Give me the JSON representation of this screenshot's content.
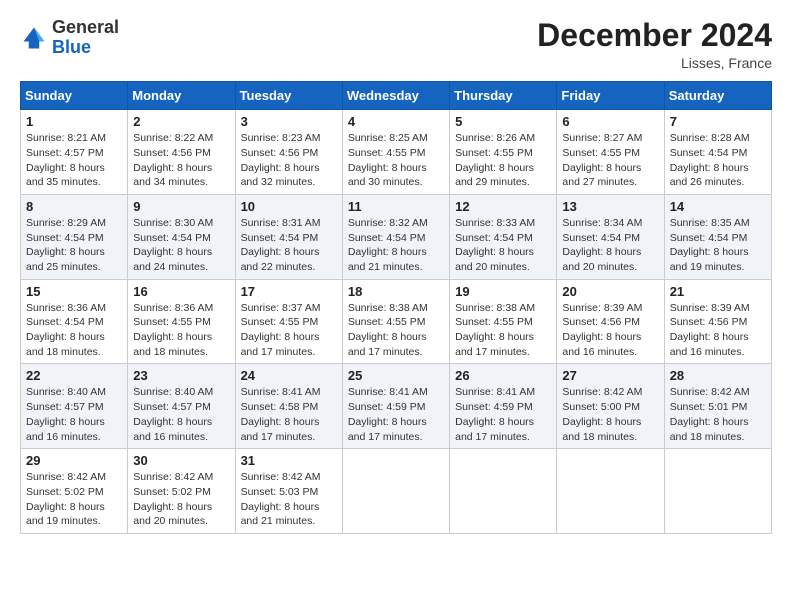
{
  "logo": {
    "general": "General",
    "blue": "Blue"
  },
  "title": "December 2024",
  "location": "Lisses, France",
  "days_of_week": [
    "Sunday",
    "Monday",
    "Tuesday",
    "Wednesday",
    "Thursday",
    "Friday",
    "Saturday"
  ],
  "weeks": [
    [
      {
        "day": "1",
        "sunrise": "8:21 AM",
        "sunset": "4:57 PM",
        "daylight": "8 hours and 35 minutes."
      },
      {
        "day": "2",
        "sunrise": "8:22 AM",
        "sunset": "4:56 PM",
        "daylight": "8 hours and 34 minutes."
      },
      {
        "day": "3",
        "sunrise": "8:23 AM",
        "sunset": "4:56 PM",
        "daylight": "8 hours and 32 minutes."
      },
      {
        "day": "4",
        "sunrise": "8:25 AM",
        "sunset": "4:55 PM",
        "daylight": "8 hours and 30 minutes."
      },
      {
        "day": "5",
        "sunrise": "8:26 AM",
        "sunset": "4:55 PM",
        "daylight": "8 hours and 29 minutes."
      },
      {
        "day": "6",
        "sunrise": "8:27 AM",
        "sunset": "4:55 PM",
        "daylight": "8 hours and 27 minutes."
      },
      {
        "day": "7",
        "sunrise": "8:28 AM",
        "sunset": "4:54 PM",
        "daylight": "8 hours and 26 minutes."
      }
    ],
    [
      {
        "day": "8",
        "sunrise": "8:29 AM",
        "sunset": "4:54 PM",
        "daylight": "8 hours and 25 minutes."
      },
      {
        "day": "9",
        "sunrise": "8:30 AM",
        "sunset": "4:54 PM",
        "daylight": "8 hours and 24 minutes."
      },
      {
        "day": "10",
        "sunrise": "8:31 AM",
        "sunset": "4:54 PM",
        "daylight": "8 hours and 22 minutes."
      },
      {
        "day": "11",
        "sunrise": "8:32 AM",
        "sunset": "4:54 PM",
        "daylight": "8 hours and 21 minutes."
      },
      {
        "day": "12",
        "sunrise": "8:33 AM",
        "sunset": "4:54 PM",
        "daylight": "8 hours and 20 minutes."
      },
      {
        "day": "13",
        "sunrise": "8:34 AM",
        "sunset": "4:54 PM",
        "daylight": "8 hours and 20 minutes."
      },
      {
        "day": "14",
        "sunrise": "8:35 AM",
        "sunset": "4:54 PM",
        "daylight": "8 hours and 19 minutes."
      }
    ],
    [
      {
        "day": "15",
        "sunrise": "8:36 AM",
        "sunset": "4:54 PM",
        "daylight": "8 hours and 18 minutes."
      },
      {
        "day": "16",
        "sunrise": "8:36 AM",
        "sunset": "4:55 PM",
        "daylight": "8 hours and 18 minutes."
      },
      {
        "day": "17",
        "sunrise": "8:37 AM",
        "sunset": "4:55 PM",
        "daylight": "8 hours and 17 minutes."
      },
      {
        "day": "18",
        "sunrise": "8:38 AM",
        "sunset": "4:55 PM",
        "daylight": "8 hours and 17 minutes."
      },
      {
        "day": "19",
        "sunrise": "8:38 AM",
        "sunset": "4:55 PM",
        "daylight": "8 hours and 17 minutes."
      },
      {
        "day": "20",
        "sunrise": "8:39 AM",
        "sunset": "4:56 PM",
        "daylight": "8 hours and 16 minutes."
      },
      {
        "day": "21",
        "sunrise": "8:39 AM",
        "sunset": "4:56 PM",
        "daylight": "8 hours and 16 minutes."
      }
    ],
    [
      {
        "day": "22",
        "sunrise": "8:40 AM",
        "sunset": "4:57 PM",
        "daylight": "8 hours and 16 minutes."
      },
      {
        "day": "23",
        "sunrise": "8:40 AM",
        "sunset": "4:57 PM",
        "daylight": "8 hours and 16 minutes."
      },
      {
        "day": "24",
        "sunrise": "8:41 AM",
        "sunset": "4:58 PM",
        "daylight": "8 hours and 17 minutes."
      },
      {
        "day": "25",
        "sunrise": "8:41 AM",
        "sunset": "4:59 PM",
        "daylight": "8 hours and 17 minutes."
      },
      {
        "day": "26",
        "sunrise": "8:41 AM",
        "sunset": "4:59 PM",
        "daylight": "8 hours and 17 minutes."
      },
      {
        "day": "27",
        "sunrise": "8:42 AM",
        "sunset": "5:00 PM",
        "daylight": "8 hours and 18 minutes."
      },
      {
        "day": "28",
        "sunrise": "8:42 AM",
        "sunset": "5:01 PM",
        "daylight": "8 hours and 18 minutes."
      }
    ],
    [
      {
        "day": "29",
        "sunrise": "8:42 AM",
        "sunset": "5:02 PM",
        "daylight": "8 hours and 19 minutes."
      },
      {
        "day": "30",
        "sunrise": "8:42 AM",
        "sunset": "5:02 PM",
        "daylight": "8 hours and 20 minutes."
      },
      {
        "day": "31",
        "sunrise": "8:42 AM",
        "sunset": "5:03 PM",
        "daylight": "8 hours and 21 minutes."
      },
      null,
      null,
      null,
      null
    ]
  ],
  "labels": {
    "sunrise": "Sunrise:",
    "sunset": "Sunset:",
    "daylight": "Daylight:"
  }
}
